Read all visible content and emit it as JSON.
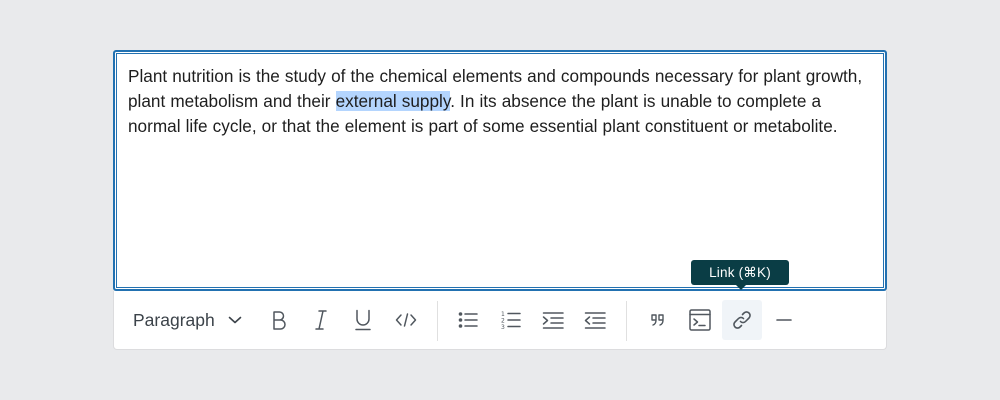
{
  "editor": {
    "text_before": "Plant nutrition is the study of the chemical elements and compounds necessary for plant growth, plant metabolism and their ",
    "text_selected": "external supply",
    "text_after": ". In its absence the plant is unable to complete a normal life cycle, or that the element is part of some essential plant constituent or metabolite.",
    "accent_color": "#2271b1",
    "selection_color": "#b4d5fe"
  },
  "toolbar": {
    "block_format": "Paragraph",
    "buttons": [
      {
        "name": "bold",
        "icon": "bold-icon"
      },
      {
        "name": "italic",
        "icon": "italic-icon"
      },
      {
        "name": "underline",
        "icon": "underline-icon"
      },
      {
        "name": "code",
        "icon": "code-icon"
      },
      {
        "name": "bulleted-list",
        "icon": "bulleted-list-icon"
      },
      {
        "name": "numbered-list",
        "icon": "numbered-list-icon"
      },
      {
        "name": "indent",
        "icon": "indent-icon"
      },
      {
        "name": "outdent",
        "icon": "outdent-icon"
      },
      {
        "name": "blockquote",
        "icon": "quote-icon"
      },
      {
        "name": "code-block",
        "icon": "terminal-icon"
      },
      {
        "name": "link",
        "icon": "link-icon",
        "active": true
      },
      {
        "name": "horizontal-rule",
        "icon": "horizontal-rule-icon"
      }
    ]
  },
  "tooltip": {
    "label": "Link (⌘K)",
    "background": "#0a3d45"
  }
}
